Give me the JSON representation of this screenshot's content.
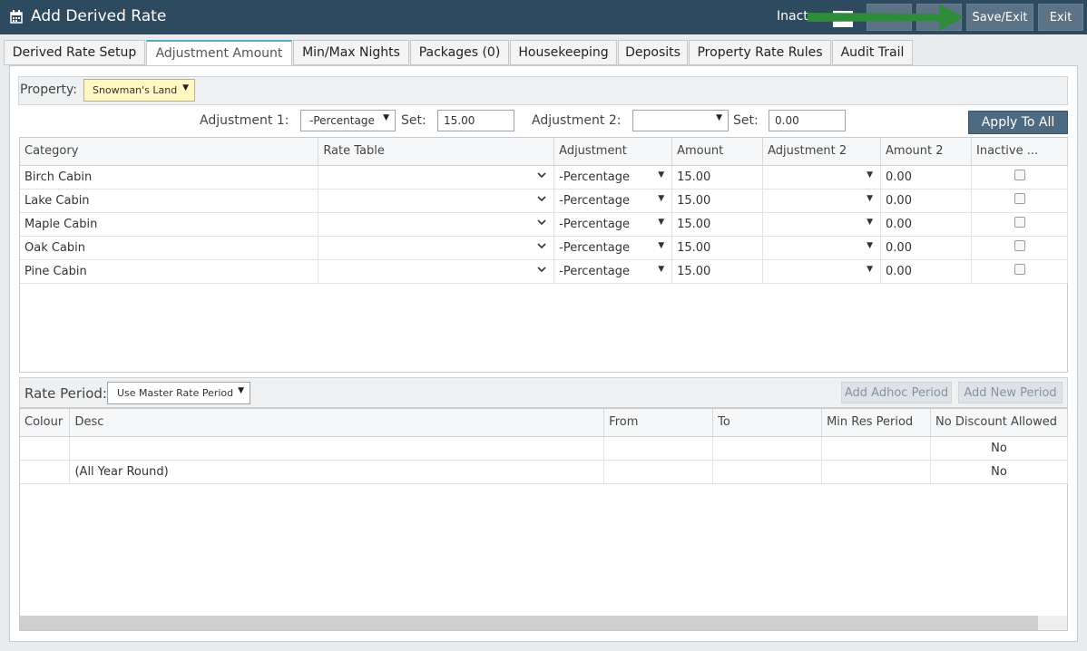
{
  "titlebar": {
    "title": "Add Derived Rate",
    "inactive_label": "Inact",
    "save_exit": "Save/Exit",
    "exit": "Exit"
  },
  "tabs": [
    {
      "label": "Derived Rate Setup"
    },
    {
      "label": "Adjustment Amount"
    },
    {
      "label": "Min/Max Nights"
    },
    {
      "label": "Packages (0)"
    },
    {
      "label": "Housekeeping"
    },
    {
      "label": "Deposits"
    },
    {
      "label": "Property Rate Rules"
    },
    {
      "label": "Audit Trail"
    }
  ],
  "property": {
    "label": "Property:",
    "value": "Snowman's Land"
  },
  "adjust_bar": {
    "adj1_label": "Adjustment 1:",
    "adj1_value": "-Percentage",
    "set1_label": "Set:",
    "set1_value": "15.00",
    "adj2_label": "Adjustment 2:",
    "adj2_value": "",
    "set2_label": "Set:",
    "set2_value": "0.00",
    "apply_all": "Apply To All"
  },
  "categories_table": {
    "headers": [
      "Category",
      "Rate Table",
      "Adjustment",
      "Amount",
      "Adjustment 2",
      "Amount 2",
      "Inactive ..."
    ],
    "rows": [
      {
        "category": "Birch Cabin",
        "rate_table": "",
        "adjustment": "-Percentage",
        "amount": "15.00",
        "adjustment2": "",
        "amount2": "0.00"
      },
      {
        "category": "Lake Cabin",
        "rate_table": "",
        "adjustment": "-Percentage",
        "amount": "15.00",
        "adjustment2": "",
        "amount2": "0.00"
      },
      {
        "category": "Maple Cabin",
        "rate_table": "",
        "adjustment": "-Percentage",
        "amount": "15.00",
        "adjustment2": "",
        "amount2": "0.00"
      },
      {
        "category": "Oak Cabin",
        "rate_table": "",
        "adjustment": "-Percentage",
        "amount": "15.00",
        "adjustment2": "",
        "amount2": "0.00"
      },
      {
        "category": "Pine Cabin",
        "rate_table": "",
        "adjustment": "-Percentage",
        "amount": "15.00",
        "adjustment2": "",
        "amount2": "0.00"
      }
    ]
  },
  "rate_period": {
    "label": "Rate Period:",
    "value": "Use Master Rate Period",
    "add_adhoc": "Add Adhoc Period",
    "add_new": "Add New Period"
  },
  "periods_table": {
    "headers": [
      "Colour",
      "Desc",
      "From",
      "To",
      "Min Res Period",
      "No Discount Allowed"
    ],
    "rows": [
      {
        "colour": "",
        "desc": "",
        "from": "",
        "to": "",
        "min_res": "",
        "no_discount": "No"
      },
      {
        "colour": "",
        "desc": "(All Year Round)",
        "from": "",
        "to": "",
        "min_res": "",
        "no_discount": "No"
      }
    ]
  },
  "colors": {
    "titlebar": "#2e4a5f",
    "accent_tab": "#5aa9c9",
    "arrow": "#2e8b3a",
    "property_select": "#fff8c2"
  }
}
